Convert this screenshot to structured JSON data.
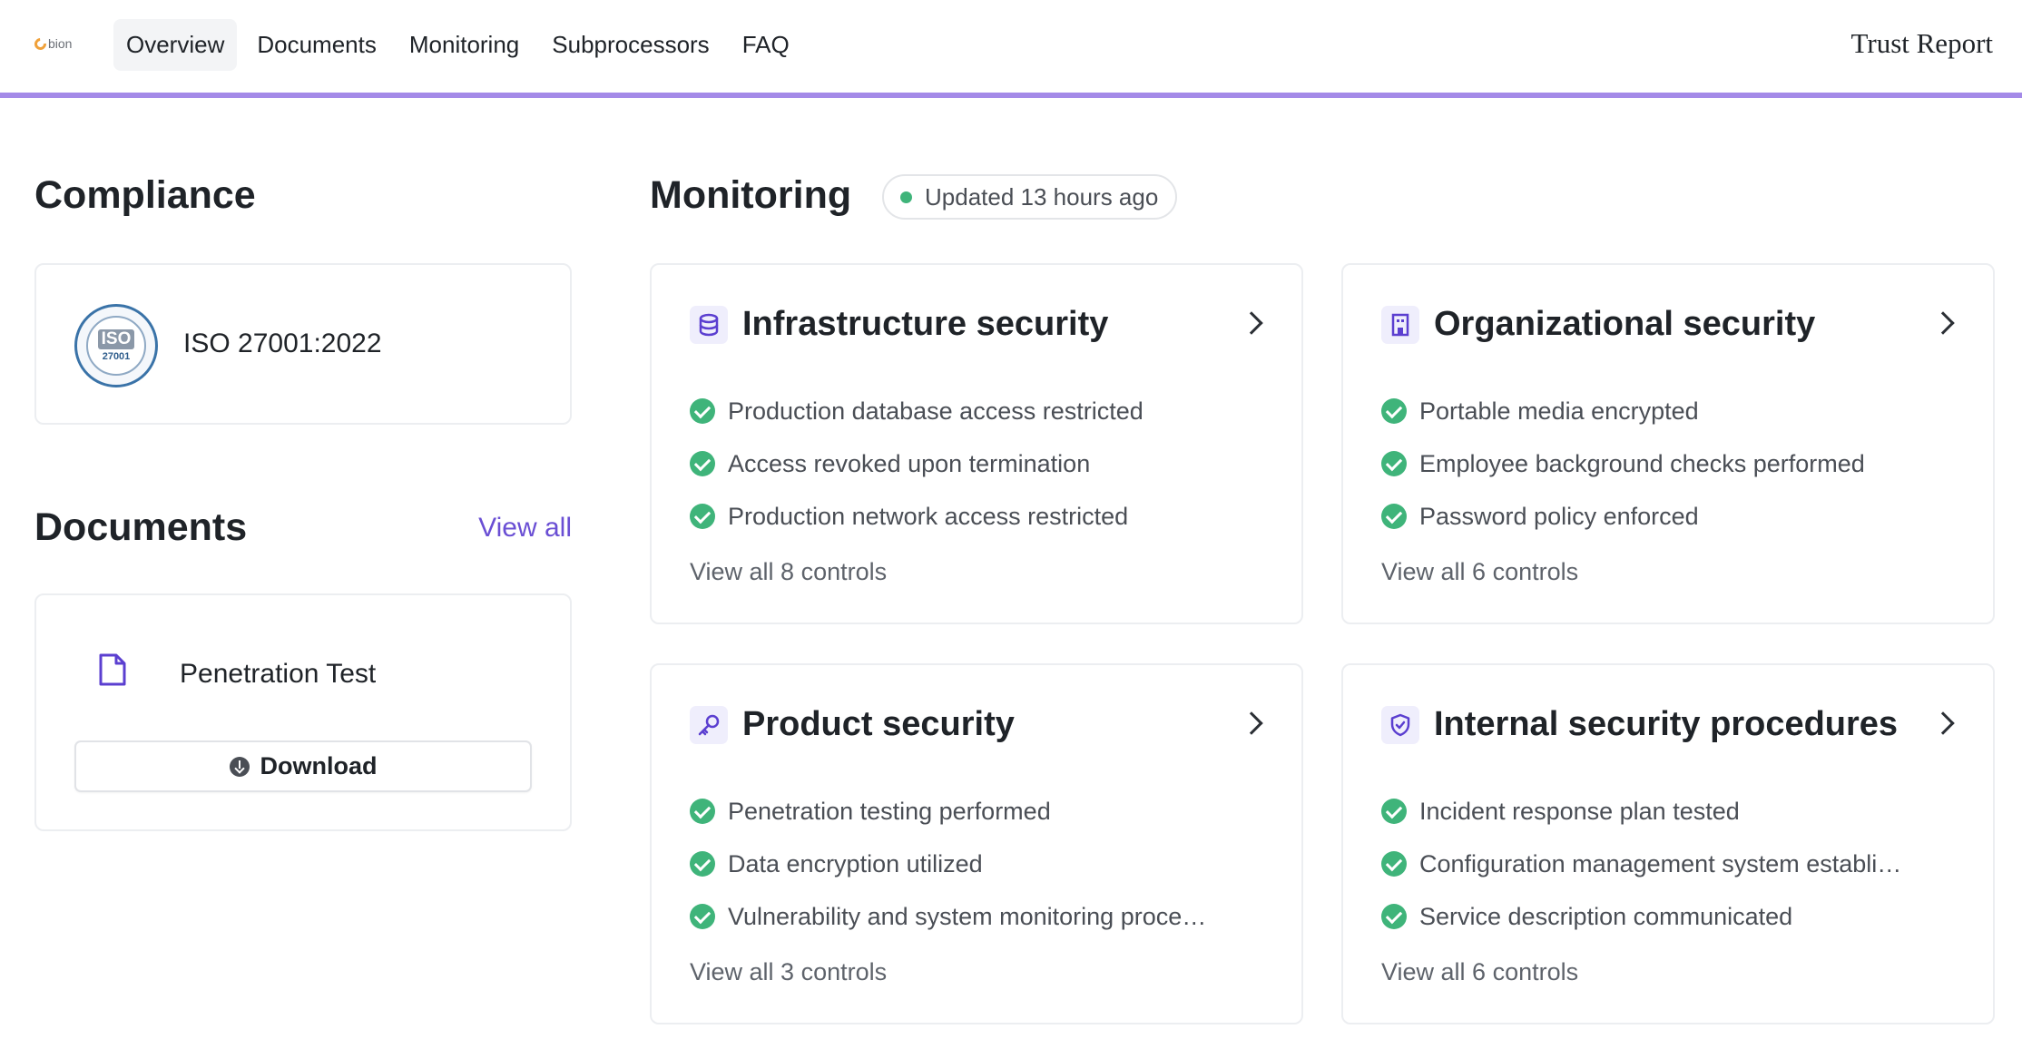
{
  "header": {
    "logo_text": "bion",
    "nav": [
      {
        "label": "Overview",
        "active": true
      },
      {
        "label": "Documents",
        "active": false
      },
      {
        "label": "Monitoring",
        "active": false
      },
      {
        "label": "Subprocessors",
        "active": false
      },
      {
        "label": "FAQ",
        "active": false
      }
    ],
    "brand_title": "Trust Report"
  },
  "compliance": {
    "heading": "Compliance",
    "certifications": [
      {
        "label": "ISO 27001:2022",
        "badge_text": "ISO",
        "badge_number": "27001"
      }
    ]
  },
  "documents": {
    "heading": "Documents",
    "view_all": "View all",
    "items": [
      {
        "label": "Penetration Test",
        "action": "Download"
      }
    ]
  },
  "monitoring": {
    "heading": "Monitoring",
    "status": "Updated 13 hours ago",
    "cards": [
      {
        "title": "Infrastructure security",
        "icon": "database-icon",
        "controls": [
          "Production database access restricted",
          "Access revoked upon termination",
          "Production network access restricted"
        ],
        "view_all": "View all 8 controls"
      },
      {
        "title": "Organizational security",
        "icon": "building-icon",
        "controls": [
          "Portable media encrypted",
          "Employee background checks performed",
          "Password policy enforced"
        ],
        "view_all": "View all 6 controls"
      },
      {
        "title": "Product security",
        "icon": "key-icon",
        "controls": [
          "Penetration testing performed",
          "Data encryption utilized",
          "Vulnerability and system monitoring proce…"
        ],
        "view_all": "View all 3 controls"
      },
      {
        "title": "Internal security procedures",
        "icon": "shield-check-icon",
        "controls": [
          "Incident response plan tested",
          "Configuration management system establi…",
          "Service description communicated"
        ],
        "view_all": "View all 6 controls"
      }
    ]
  },
  "colors": {
    "accent": "#6a4fd4",
    "nav_underline": "#a48ae8",
    "check_green": "#3fb47a",
    "icon_bg": "#efeefc"
  }
}
